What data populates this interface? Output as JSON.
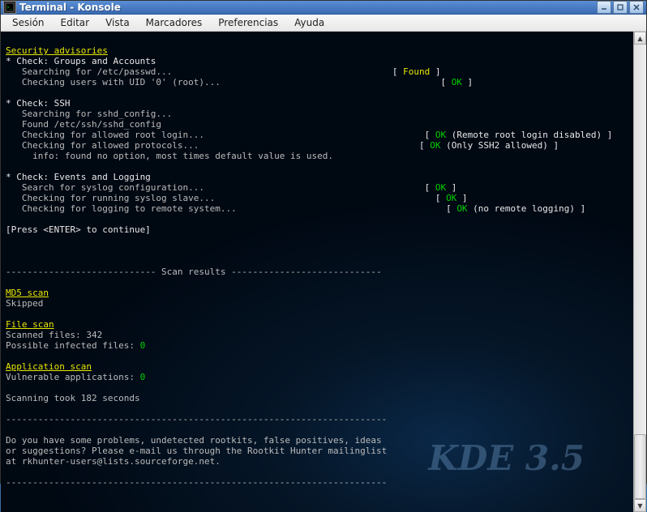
{
  "window": {
    "title": "Terminal - Konsole"
  },
  "menubar": {
    "items": [
      "Sesión",
      "Editar",
      "Vista",
      "Marcadores",
      "Preferencias",
      "Ayuda"
    ]
  },
  "watermark": "KDE 3.5",
  "terminal": {
    "sections": {
      "sec_advisories": "Security advisories",
      "chk_groups": "* Check: Groups and Accounts",
      "srch_passwd": "   Searching for /etc/passwd...",
      "res_found": "Found",
      "chk_uid0": "   Checking users with UID '0' (root)...",
      "res_ok": "OK",
      "chk_ssh": "* Check: SSH",
      "srch_sshd": "   Searching for sshd_config...",
      "found_sshd": "   Found /etc/ssh/sshd_config",
      "chk_rootlogin": "   Checking for allowed root login...",
      "note_root": " (Remote root login disabled) ",
      "chk_protocols": "   Checking for allowed protocols...",
      "note_ssh2": " (Only SSH2 allowed) ",
      "info_noopt": "     info: found no option, most times default value is used.",
      "chk_events": "* Check: Events and Logging",
      "srch_syslog": "   Search for syslog configuration...",
      "chk_syslogslave": "   Checking for running syslog slave...",
      "chk_remotelog": "   Checking for logging to remote system...",
      "note_noremote": " (no remote logging) ",
      "press_enter": "[Press <ENTER> to continue]",
      "dashline1": "---------------------------- Scan results ----------------------------",
      "md5_hdr": "MD5 scan",
      "md5_skip": "Skipped",
      "file_hdr": "File scan",
      "scanned_lbl": "Scanned files: ",
      "scanned_val": "342",
      "infected_lbl": "Possible infected files: ",
      "infected_val": "0",
      "app_hdr": "Application scan",
      "vuln_lbl": "Vulnerable applications: ",
      "vuln_val": "0",
      "scantime": "Scanning took 182 seconds",
      "dashline2": "-----------------------------------------------------------------------",
      "footer1": "Do you have some problems, undetected rootkits, false positives, ideas",
      "footer2": "or suggestions? Please e-mail us through the Rootkit Hunter mailinglist",
      "footer3": "at rkhunter-users@lists.sourceforge.net.",
      "dashline3": "-----------------------------------------------------------------------"
    },
    "pad": {
      "col50": "                                                 ",
      "col50b": "                                         ",
      "col50c": "                                                ",
      "col50d": "                                                  ",
      "col50e": "                                                 ",
      "col50f": "                                       "
    },
    "br": {
      "l": "[ ",
      "r": " ]"
    }
  }
}
